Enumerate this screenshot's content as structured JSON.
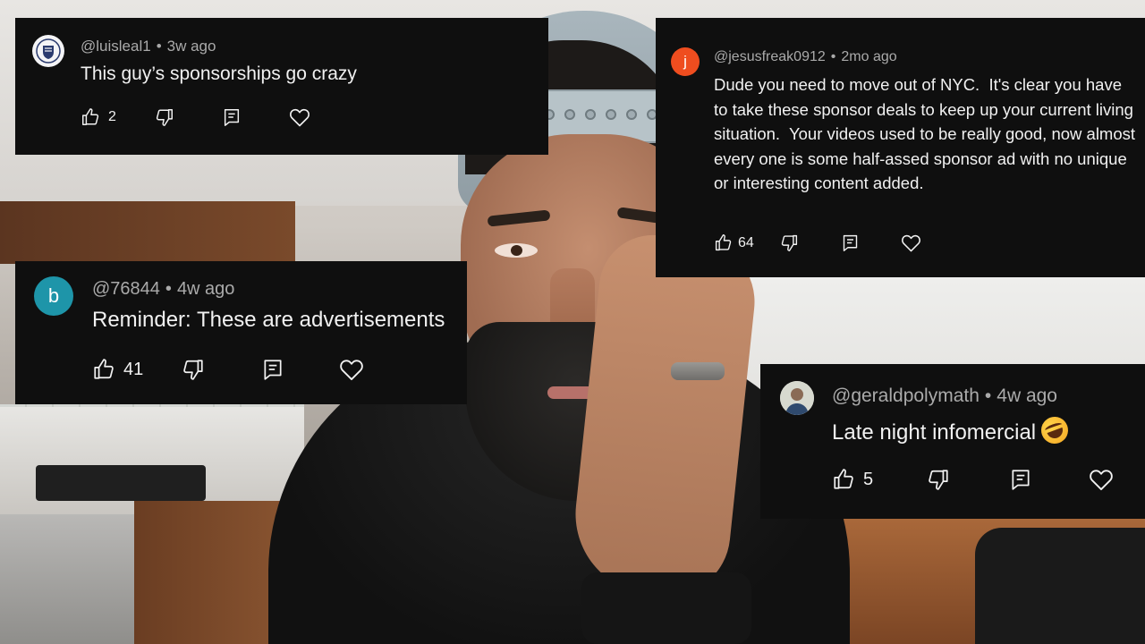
{
  "comments": [
    {
      "username": "@luisleal1",
      "time": "3w ago",
      "text": "This guy’s sponsorships go crazy",
      "likes": "2",
      "avatar": {
        "kind": "crest-logo",
        "color": "#f4f4f6"
      }
    },
    {
      "username": "@jesusfreak0912",
      "time": "2mo ago",
      "text": "Dude you need to move out of NYC.  It's clear you have to take these sponsor deals to keep up your current living situation.  Your videos used to be really good, now almost every one is some half-assed sponsor ad with no unique or interesting content added.",
      "likes": "64",
      "avatar": {
        "letter": "j",
        "color": "#ef4d1f"
      }
    },
    {
      "username": "@76844",
      "time": "4w ago",
      "text": "Reminder: These are advertisements",
      "likes": "41",
      "avatar": {
        "letter": "b",
        "color": "#1e95a9"
      }
    },
    {
      "username": "@geraldpolymath",
      "time": "4w ago",
      "text": "Late night infomercial",
      "emoji": "rolling-on-floor-laughing-emoji",
      "likes": "5",
      "avatar": {
        "kind": "photo",
        "color": "#d7d9cf"
      }
    }
  ],
  "separator": "•",
  "icons": {
    "like": "thumbs-up-icon",
    "dislike": "thumbs-down-icon",
    "reply": "reply-comment-icon",
    "heart": "heart-icon"
  },
  "colors": {
    "card_bg": "#0f0f0f",
    "text": "#f1f1f1",
    "meta": "#aaaaaa"
  }
}
